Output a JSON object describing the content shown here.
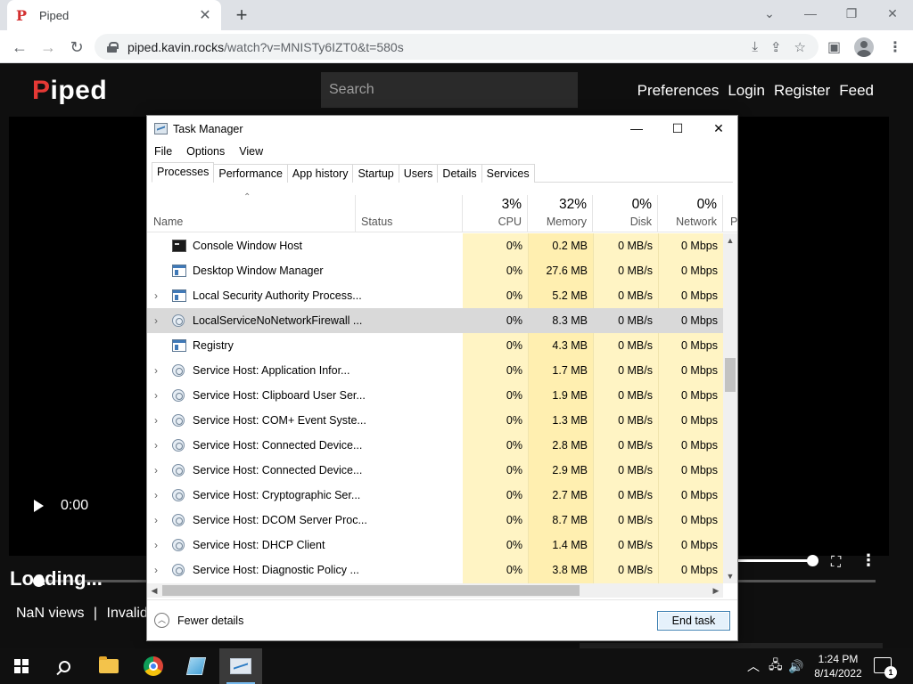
{
  "browser": {
    "tab_title": "Piped",
    "tab_favicon": "P",
    "url_host": "piped.kavin.rocks",
    "url_path": "/watch?v=MNISTy6IZT0&t=580s"
  },
  "piped": {
    "logo_first": "P",
    "logo_rest": "iped",
    "search_placeholder": "Search",
    "nav": [
      "Preferences",
      "Login",
      "Register",
      "Feed"
    ],
    "player_time": "0:00",
    "title": "Loading...",
    "views": "NaN views",
    "separator": "|",
    "date": "Invalid"
  },
  "taskmanager": {
    "title": "Task Manager",
    "menu": [
      "File",
      "Options",
      "View"
    ],
    "tabs": [
      "Processes",
      "Performance",
      "App history",
      "Startup",
      "Users",
      "Details",
      "Services"
    ],
    "active_tab": "Processes",
    "columns": {
      "name": "Name",
      "status": "Status",
      "cpu": {
        "percent": "3%",
        "label": "CPU"
      },
      "memory": {
        "percent": "32%",
        "label": "Memory"
      },
      "disk": {
        "percent": "0%",
        "label": "Disk"
      },
      "network": {
        "percent": "0%",
        "label": "Network"
      },
      "power_cut": "P"
    },
    "rows": [
      {
        "expand": "",
        "icon": "console-icon",
        "name": "Console Window Host",
        "cpu": "0%",
        "mem": "0.2 MB",
        "disk": "0 MB/s",
        "net": "0 Mbps"
      },
      {
        "expand": "",
        "icon": "window-icon",
        "name": "Desktop Window Manager",
        "cpu": "0%",
        "mem": "27.6 MB",
        "disk": "0 MB/s",
        "net": "0 Mbps"
      },
      {
        "expand": ">",
        "icon": "window-icon",
        "name": "Local Security Authority Process...",
        "cpu": "0%",
        "mem": "5.2 MB",
        "disk": "0 MB/s",
        "net": "0 Mbps"
      },
      {
        "expand": ">",
        "icon": "gear-icon",
        "name": "LocalServiceNoNetworkFirewall ...",
        "cpu": "0%",
        "mem": "8.3 MB",
        "disk": "0 MB/s",
        "net": "0 Mbps",
        "selected": true
      },
      {
        "expand": "",
        "icon": "window-icon",
        "name": "Registry",
        "cpu": "0%",
        "mem": "4.3 MB",
        "disk": "0 MB/s",
        "net": "0 Mbps"
      },
      {
        "expand": ">",
        "icon": "gear-icon",
        "name": "Service Host: Application Infor...",
        "cpu": "0%",
        "mem": "1.7 MB",
        "disk": "0 MB/s",
        "net": "0 Mbps"
      },
      {
        "expand": ">",
        "icon": "gear-icon",
        "name": "Service Host: Clipboard User Ser...",
        "cpu": "0%",
        "mem": "1.9 MB",
        "disk": "0 MB/s",
        "net": "0 Mbps"
      },
      {
        "expand": ">",
        "icon": "gear-icon",
        "name": "Service Host: COM+ Event Syste...",
        "cpu": "0%",
        "mem": "1.3 MB",
        "disk": "0 MB/s",
        "net": "0 Mbps"
      },
      {
        "expand": ">",
        "icon": "gear-icon",
        "name": "Service Host: Connected Device...",
        "cpu": "0%",
        "mem": "2.8 MB",
        "disk": "0 MB/s",
        "net": "0 Mbps"
      },
      {
        "expand": ">",
        "icon": "gear-icon",
        "name": "Service Host: Connected Device...",
        "cpu": "0%",
        "mem": "2.9 MB",
        "disk": "0 MB/s",
        "net": "0 Mbps"
      },
      {
        "expand": ">",
        "icon": "gear-icon",
        "name": "Service Host: Cryptographic Ser...",
        "cpu": "0%",
        "mem": "2.7 MB",
        "disk": "0 MB/s",
        "net": "0 Mbps"
      },
      {
        "expand": ">",
        "icon": "gear-icon",
        "name": "Service Host: DCOM Server Proc...",
        "cpu": "0%",
        "mem": "8.7 MB",
        "disk": "0 MB/s",
        "net": "0 Mbps"
      },
      {
        "expand": ">",
        "icon": "gear-icon",
        "name": "Service Host: DHCP Client",
        "cpu": "0%",
        "mem": "1.4 MB",
        "disk": "0 MB/s",
        "net": "0 Mbps"
      },
      {
        "expand": ">",
        "icon": "gear-icon",
        "name": "Service Host: Diagnostic Policy ...",
        "cpu": "0%",
        "mem": "3.8 MB",
        "disk": "0 MB/s",
        "net": "0 Mbps"
      }
    ],
    "fewer_details": "Fewer details",
    "end_task": "End task"
  },
  "taskbar": {
    "time": "1:24 PM",
    "date": "8/14/2022",
    "notification_count": "1"
  }
}
